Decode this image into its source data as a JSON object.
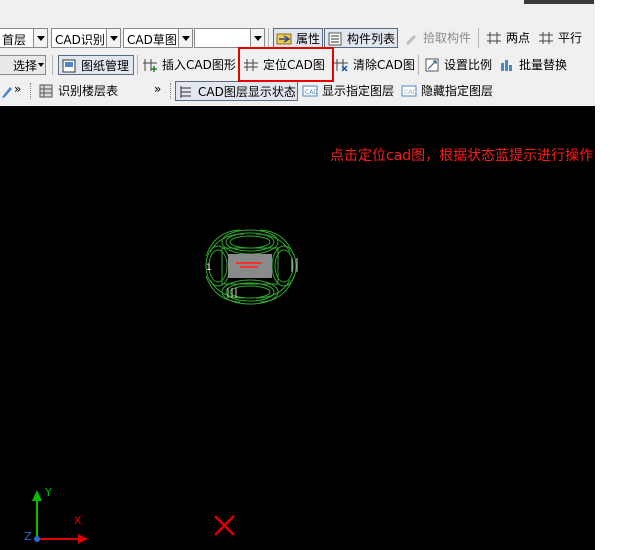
{
  "toolbar": {
    "row1": {
      "floor_combo": "首层",
      "cad_identify_combo": "CAD识别",
      "cad_sketch_combo": "CAD草图",
      "empty_combo": "",
      "properties": "属性",
      "component_list": "构件列表",
      "pick_component": "拾取构件",
      "two_points": "两点",
      "parallel": "平行"
    },
    "row2": {
      "select": "选择",
      "drawing_manage": "图纸管理",
      "insert_cad": "插入CAD图形",
      "locate_cad": "定位CAD图",
      "clear_cad": "清除CAD图",
      "set_scale": "设置比例",
      "batch_replace": "批量替换"
    },
    "row3": {
      "identify_floor_table": "识别楼层表",
      "cad_layer_display": "CAD图层显示状态",
      "show_layer": "显示指定图层",
      "hide_layer": "隐藏指定图层"
    }
  },
  "annotation": "点击定位cad图，根据状态蓝提示进行操作",
  "axes": {
    "y_label": "Y",
    "x_label": "X",
    "z_label": "Z"
  },
  "colors": {
    "highlight": "#e60000",
    "annotation": "#ff1a1a",
    "drawing": "#2ea82e",
    "canvas": "#000000"
  }
}
